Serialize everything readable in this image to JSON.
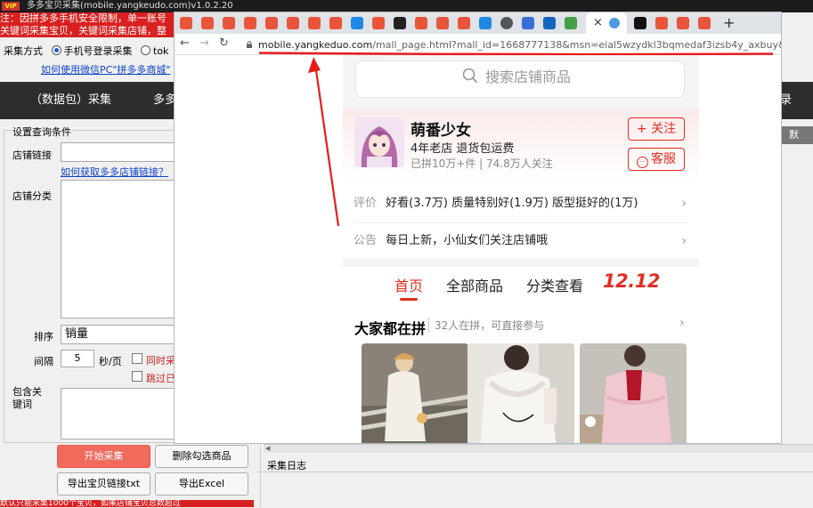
{
  "app": {
    "title": "多多宝贝采集(mobile.yangkeudo.com)v1.0.2.20",
    "vip_badge": "VIP",
    "notice_1": "注：因拼多多手机安全限制，单一账号",
    "notice_2": "关键词采集宝贝，关键词采集店铺，整",
    "mode_label": "采集方式",
    "mode_option_1": "手机号登录采集",
    "mode_option_2": "tok",
    "wechat_help": "如何使用微信PC\"拼多多商城\"",
    "tabs": [
      "（数据包）采集",
      "多多",
      "录"
    ],
    "right_side_button": "默"
  },
  "conditions": {
    "group_title": "设置查询条件",
    "shop_link_label": "店铺链接",
    "shop_link_help": "如何获取多多店铺链接？",
    "shop_category_label": "店铺分类",
    "sort_label": "排序",
    "sort_value": "销量",
    "interval_label": "间隔",
    "interval_value": "5",
    "interval_unit": "秒/页",
    "option_1": "同时采",
    "option_2": "跳过已",
    "keywords_label": "包含关键词"
  },
  "buttons": {
    "start": "开始采集",
    "delete_checked": "删除勾选商品",
    "export_txt": "导出宝贝链接txt",
    "export_excel": "导出Excel"
  },
  "bottom_notice": "默认只能采集1000个宝贝，如果店铺宝贝总数超过",
  "log": {
    "title": "采集日志"
  },
  "browser": {
    "url_host": "mobile.yangkeduo.com",
    "url_path": "/mall_page.html?mall_id=1668777138&msn=eial5wzydkl3bqmedaf3izsb4y_axbuy&has_decoration=...",
    "new_tab": "+",
    "close_tab": "×"
  },
  "mobile": {
    "search_placeholder": "搜索店铺商品",
    "shop_name": "萌番少女",
    "shop_tags": "4年老店  退货包运费",
    "shop_stats": "已拼10万+件 | 74.8万人关注",
    "follow_button": "+ 关注",
    "service_button": "客服",
    "review_label": "评价",
    "review_tags": "好看(3.7万)  质量特别好(1.9万)  版型挺好的(1万)",
    "notice_label": "公告",
    "notice_text": "每日上新，小仙女们关注店铺哦",
    "nav_tabs": [
      "首页",
      "全部商品",
      "分类查看"
    ],
    "promo_tab": "12.12",
    "section_title": "大家都在拼",
    "section_subtitle": "32人在拼，可直接参与"
  },
  "colors": {
    "pdd_red": "#e02e24",
    "notice_red": "#d92020",
    "start_button": "#f16a5c",
    "dark_tabbar": "#2d2d2d"
  }
}
